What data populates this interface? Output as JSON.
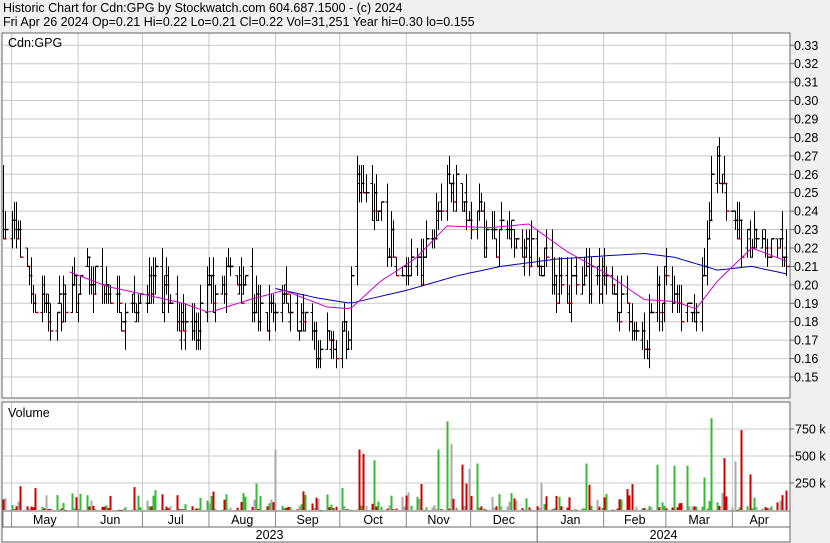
{
  "header": {
    "line1": "Historic Chart for Cdn:GPG by Stockwatch.com 604.687.1500 - (c) 2024",
    "line2": "Fri Apr 26 2024  Op=0.21  Hi=0.22  Lo=0.21  Cl=0.22  Vol=31,251  Year hi=0.30  lo=0.155"
  },
  "colors": {
    "background": "#ffffff",
    "grid": "#c8c8c8",
    "up": "#000000",
    "down": "#cc0000",
    "ma_short": "#cc00cc",
    "ma_long": "#0000aa",
    "vol_up": "#33bb33",
    "vol_down": "#cc0000",
    "vol_flat": "#aaaaaa"
  },
  "chart_data": [
    {
      "type": "ohlc",
      "title": "Cdn:GPG",
      "ylim": [
        0.14,
        0.34
      ],
      "y_ticks": [
        0.15,
        0.16,
        0.17,
        0.18,
        0.19,
        0.2,
        0.21,
        0.22,
        0.23,
        0.24,
        0.25,
        0.26,
        0.27,
        0.28,
        0.29,
        0.3,
        0.31,
        0.32,
        0.33
      ],
      "y_tick_labels": [
        "0.15",
        "0.16",
        "0.17",
        "0.18",
        "0.19",
        "0.20",
        "0.21",
        "0.22",
        "0.23",
        "0.24",
        "0.25",
        "0.26",
        "0.27",
        "0.28",
        "0.29",
        "0.30",
        "0.31",
        "0.32",
        "0.33"
      ],
      "x_months": [
        "May",
        "Jun",
        "Jul",
        "Aug",
        "Sep",
        "Oct",
        "Nov",
        "Dec",
        "Jan",
        "Feb",
        "Mar",
        "Apr"
      ],
      "x_years": [
        "2023",
        "2024"
      ],
      "grid": true,
      "anchors": [
        [
          "2023-04-27",
          0.235
        ],
        [
          "2023-05-05",
          0.22
        ],
        [
          "2023-05-12",
          0.19
        ],
        [
          "2023-05-20",
          0.185
        ],
        [
          "2023-05-28",
          0.19
        ],
        [
          "2023-06-05",
          0.205
        ],
        [
          "2023-06-14",
          0.2
        ],
        [
          "2023-06-22",
          0.18
        ],
        [
          "2023-06-30",
          0.195
        ],
        [
          "2023-07-08",
          0.2
        ],
        [
          "2023-07-16",
          0.185
        ],
        [
          "2023-07-25",
          0.175
        ],
        [
          "2023-08-02",
          0.2
        ],
        [
          "2023-08-10",
          0.205
        ],
        [
          "2023-08-18",
          0.2
        ],
        [
          "2023-08-26",
          0.18
        ],
        [
          "2023-09-03",
          0.195
        ],
        [
          "2023-09-12",
          0.18
        ],
        [
          "2023-09-20",
          0.17
        ],
        [
          "2023-09-28",
          0.17
        ],
        [
          "2023-10-05",
          0.175
        ],
        [
          "2023-10-08",
          0.25
        ],
        [
          "2023-10-12",
          0.26
        ],
        [
          "2023-10-18",
          0.24
        ],
        [
          "2023-10-25",
          0.22
        ],
        [
          "2023-11-01",
          0.205
        ],
        [
          "2023-11-08",
          0.21
        ],
        [
          "2023-11-15",
          0.24
        ],
        [
          "2023-11-20",
          0.26
        ],
        [
          "2023-11-26",
          0.245
        ],
        [
          "2023-12-04",
          0.235
        ],
        [
          "2023-12-12",
          0.225
        ],
        [
          "2023-12-20",
          0.23
        ],
        [
          "2023-12-28",
          0.215
        ],
        [
          "2024-01-05",
          0.215
        ],
        [
          "2024-01-12",
          0.195
        ],
        [
          "2024-01-20",
          0.2
        ],
        [
          "2024-01-28",
          0.205
        ],
        [
          "2024-02-05",
          0.195
        ],
        [
          "2024-02-13",
          0.18
        ],
        [
          "2024-02-20",
          0.165
        ],
        [
          "2024-02-24",
          0.19
        ],
        [
          "2024-03-02",
          0.195
        ],
        [
          "2024-03-08",
          0.18
        ],
        [
          "2024-03-14",
          0.185
        ],
        [
          "2024-03-19",
          0.2
        ],
        [
          "2024-03-23",
          0.27
        ],
        [
          "2024-03-30",
          0.24
        ],
        [
          "2024-04-06",
          0.22
        ],
        [
          "2024-04-14",
          0.22
        ],
        [
          "2024-04-20",
          0.215
        ],
        [
          "2024-04-26",
          0.22
        ]
      ],
      "ma_short_anchors": [
        [
          "2023-05-28",
          0.207
        ],
        [
          "2023-06-15",
          0.199
        ],
        [
          "2023-07-01",
          0.195
        ],
        [
          "2023-07-20",
          0.19
        ],
        [
          "2023-08-01",
          0.185
        ],
        [
          "2023-08-20",
          0.192
        ],
        [
          "2023-09-05",
          0.197
        ],
        [
          "2023-09-25",
          0.188
        ],
        [
          "2023-10-06",
          0.187
        ],
        [
          "2023-10-20",
          0.202
        ],
        [
          "2023-11-05",
          0.214
        ],
        [
          "2023-11-20",
          0.232
        ],
        [
          "2023-12-10",
          0.231
        ],
        [
          "2023-12-28",
          0.233
        ],
        [
          "2024-01-15",
          0.218
        ],
        [
          "2024-02-01",
          0.207
        ],
        [
          "2024-02-20",
          0.192
        ],
        [
          "2024-03-05",
          0.191
        ],
        [
          "2024-03-15",
          0.187
        ],
        [
          "2024-03-25",
          0.202
        ],
        [
          "2024-04-10",
          0.22
        ],
        [
          "2024-04-26",
          0.213
        ]
      ],
      "ma_long_anchors": [
        [
          "2023-09-01",
          0.198
        ],
        [
          "2023-09-20",
          0.193
        ],
        [
          "2023-10-06",
          0.19
        ],
        [
          "2023-11-01",
          0.197
        ],
        [
          "2023-11-25",
          0.205
        ],
        [
          "2023-12-15",
          0.21
        ],
        [
          "2024-01-10",
          0.214
        ],
        [
          "2024-02-05",
          0.216
        ],
        [
          "2024-02-20",
          0.217
        ],
        [
          "2024-03-05",
          0.215
        ],
        [
          "2024-03-25",
          0.208
        ],
        [
          "2024-04-10",
          0.21
        ],
        [
          "2024-04-26",
          0.206
        ]
      ],
      "spikes": [
        {
          "date": "2023-04-27",
          "high": 0.265
        },
        {
          "date": "2023-10-08",
          "high": 0.295,
          "low": 0.175
        },
        {
          "date": "2023-11-21",
          "high": 0.27
        },
        {
          "date": "2024-03-23",
          "high": 0.3,
          "low": 0.22
        },
        {
          "date": "2024-02-22",
          "low": 0.155
        }
      ]
    },
    {
      "type": "bar",
      "title": "Volume",
      "ylim": [
        0,
        1000000
      ],
      "y_ticks": [
        250000,
        500000,
        750000
      ],
      "y_tick_labels": [
        "250 k",
        "500 k",
        "750 k"
      ],
      "spikes": [
        {
          "date": "2023-09-01",
          "value": 560000
        },
        {
          "date": "2023-10-07",
          "value": 1000000
        },
        {
          "date": "2023-10-10",
          "value": 560000
        },
        {
          "date": "2023-10-12",
          "value": 520000
        },
        {
          "date": "2023-10-17",
          "value": 460000
        },
        {
          "date": "2023-11-20",
          "value": 820000
        },
        {
          "date": "2023-11-22",
          "value": 610000
        },
        {
          "date": "2023-11-16",
          "value": 560000
        },
        {
          "date": "2023-11-27",
          "value": 420000
        },
        {
          "date": "2023-11-30",
          "value": 380000
        },
        {
          "date": "2023-12-04",
          "value": 430000
        },
        {
          "date": "2024-01-24",
          "value": 430000
        },
        {
          "date": "2024-02-26",
          "value": 420000
        },
        {
          "date": "2024-03-05",
          "value": 410000
        },
        {
          "date": "2024-03-11",
          "value": 410000
        },
        {
          "date": "2024-03-22",
          "value": 850000
        },
        {
          "date": "2024-03-28",
          "value": 480000
        },
        {
          "date": "2024-04-02",
          "value": 450000
        },
        {
          "date": "2024-04-05",
          "value": 740000
        },
        {
          "date": "2024-03-19",
          "value": 300000
        },
        {
          "date": "2024-04-09",
          "value": 330000
        }
      ]
    }
  ]
}
